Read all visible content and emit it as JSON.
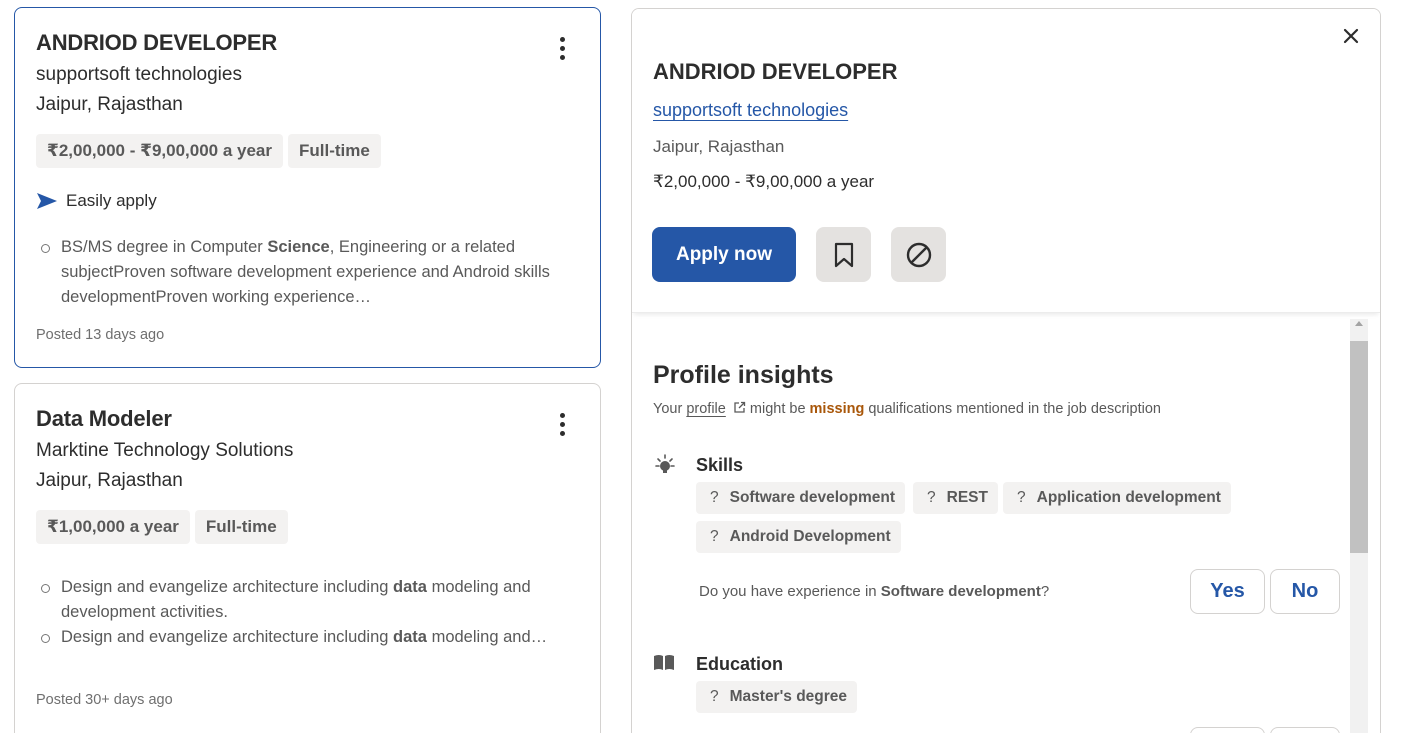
{
  "jobs": [
    {
      "title": "ANDRIOD DEVELOPER",
      "company": "supportsoft technologies",
      "location": "Jaipur, Rajasthan",
      "salary": "₹2,00,000 - ₹9,00,000 a year",
      "job_type": "Full-time",
      "easily_apply": "Easily apply",
      "snippet": {
        "pre": "BS/MS degree in Computer ",
        "bold": "Science",
        "post": ", Engineering or a related subjectProven software development experience and Android skills developmentProven working experience…"
      },
      "posted": "Posted 13 days ago"
    },
    {
      "title": "Data Modeler",
      "company": "Marktine Technology Solutions",
      "location": "Jaipur, Rajasthan",
      "salary": "₹1,00,000 a year",
      "job_type": "Full-time",
      "snippet_items": [
        {
          "pre": "Design and evangelize architecture including ",
          "bold": "data",
          "post": " modeling and development activities."
        },
        {
          "pre": "Design and evangelize architecture including ",
          "bold": "data",
          "post": " modeling and…"
        }
      ],
      "posted": "Posted 30+ days ago"
    }
  ],
  "detail": {
    "title": "ANDRIOD DEVELOPER",
    "company": "supportsoft technologies",
    "location": "Jaipur, Rajasthan",
    "salary": "₹2,00,000 - ₹9,00,000 a year",
    "apply_label": "Apply now",
    "close_icon": "close-icon",
    "save_icon": "bookmark-icon",
    "not_interested_icon": "block-icon"
  },
  "insights": {
    "title": "Profile insights",
    "sub_pre": "Your ",
    "sub_link": "profile",
    "sub_mid": " might be ",
    "sub_missing": "missing",
    "sub_post": " qualifications mentioned in the job description",
    "skills_label": "Skills",
    "skills": [
      "Software development",
      "REST",
      "Application development",
      "Android Development"
    ],
    "question_pre": "Do you have experience in ",
    "question_bold": "Software development",
    "question_post": "?",
    "yes_label": "Yes",
    "no_label": "No",
    "education_label": "Education",
    "education": [
      "Master's degree"
    ],
    "unknown_mark": "?"
  },
  "colors": {
    "accent": "#2557a7",
    "missing": "#a9570a",
    "tag_bg": "#f3f2f1",
    "text": "#2d2d2d",
    "muted": "#595959"
  }
}
